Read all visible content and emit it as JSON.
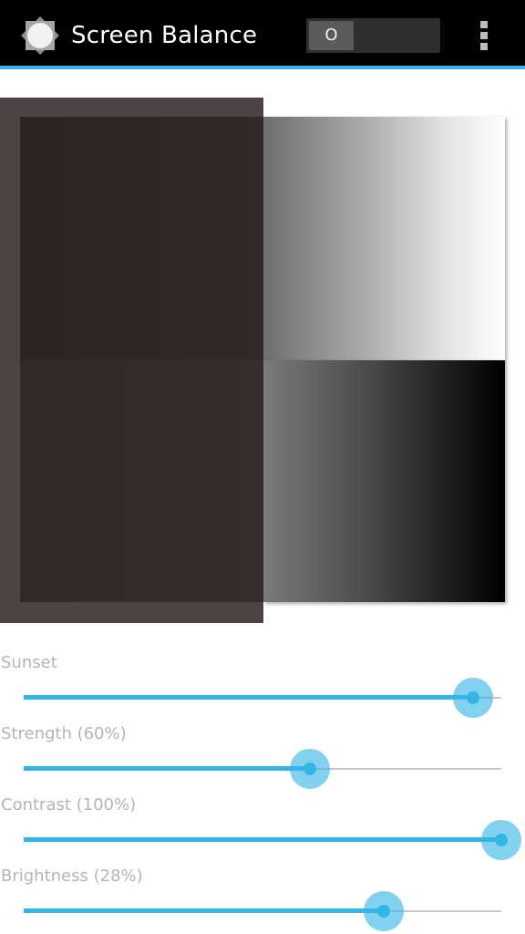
{
  "app_bar": {
    "title": "Screen Balance",
    "icon": "screen-balance-icon",
    "toggle_label": "O",
    "toggle_state": "off",
    "overflow_icon": "more-vert-icon",
    "background_color": "#000000",
    "accent_color": "#33b5e5"
  },
  "sliders": [
    {
      "label": "Sunset",
      "value_fraction": 0.94
    },
    {
      "label": "Strength (60%)",
      "value_fraction": 0.6
    },
    {
      "label": "Contrast (100%)",
      "value_fraction": 1.0
    },
    {
      "label": "Brightness (28%)",
      "value_fraction": 0.753
    }
  ],
  "colors": {
    "slider_accent": "#33b5e5",
    "label_text": "#b5b5b5"
  }
}
